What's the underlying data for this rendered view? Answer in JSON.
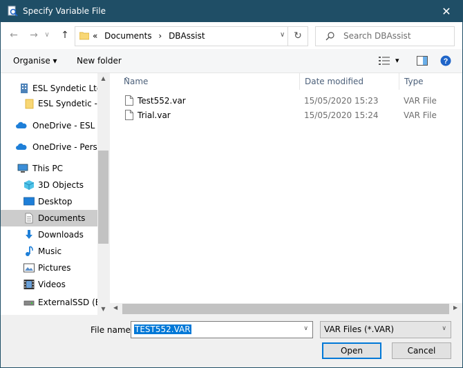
{
  "window": {
    "title": "Specify Variable File",
    "close_glyph": "✕"
  },
  "nav": {
    "back_glyph": "←",
    "forward_glyph": "→",
    "recent_glyph": "∨",
    "up_glyph": "↑",
    "address": {
      "overflow": "«",
      "crumbs": [
        "Documents",
        "DBAssist"
      ],
      "separator": "›",
      "dropdown_glyph": "∨",
      "refresh_glyph": "↻"
    },
    "search_placeholder": "Search DBAssist"
  },
  "toolbar": {
    "organise": "Organise ▾",
    "new_folder": "New folder",
    "view_dd": "▾"
  },
  "sidebar": {
    "items": [
      {
        "label": "ESL Syndetic Ltd",
        "icon": "building-icon"
      },
      {
        "label": "ESL Syndetic - ES",
        "icon": "folder-icon"
      },
      {
        "label": "OneDrive - ESL Sy",
        "icon": "cloud-icon"
      },
      {
        "label": "OneDrive - Persor",
        "icon": "cloud-icon"
      },
      {
        "label": "This PC",
        "icon": "computer-icon"
      },
      {
        "label": "3D Objects",
        "icon": "cube-icon"
      },
      {
        "label": "Desktop",
        "icon": "desktop-icon"
      },
      {
        "label": "Documents",
        "icon": "document-icon",
        "selected": true
      },
      {
        "label": "Downloads",
        "icon": "download-icon"
      },
      {
        "label": "Music",
        "icon": "music-icon"
      },
      {
        "label": "Pictures",
        "icon": "pictures-icon"
      },
      {
        "label": "Videos",
        "icon": "videos-icon"
      },
      {
        "label": "ExternalSSD (B:)",
        "icon": "drive-icon"
      }
    ]
  },
  "columns": {
    "name": "Name",
    "date": "Date modified",
    "type": "Type",
    "sort_glyph": "^"
  },
  "files": [
    {
      "name": "Test552.var",
      "date": "15/05/2020 15:23",
      "type": "VAR File"
    },
    {
      "name": "Trial.var",
      "date": "15/05/2020 15:24",
      "type": "VAR File"
    }
  ],
  "footer": {
    "file_name_label": "File name:",
    "file_name_value": "TEST552.VAR",
    "file_type": "VAR Files (*.VAR)",
    "open": "Open",
    "cancel": "Cancel",
    "dropdown_glyph": "∨"
  },
  "colors": {
    "titlebar": "#1f4e66",
    "accent": "#0078d7",
    "selected": "#cccccc"
  }
}
